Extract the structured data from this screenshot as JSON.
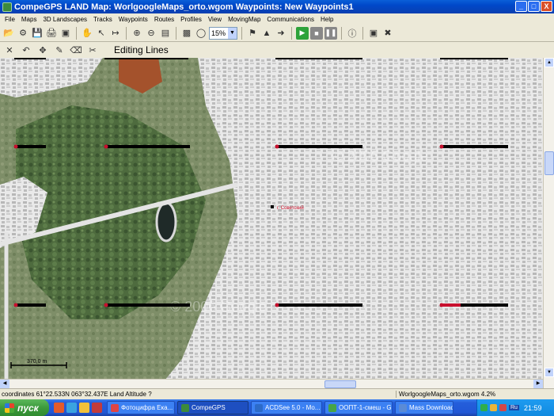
{
  "window": {
    "title": "CompeGPS LAND Map: WorlgoogleMaps_orto.wgom Waypoints:  New Waypoints1",
    "controls": [
      "_",
      "□",
      "X"
    ]
  },
  "menu": [
    "File",
    "Maps",
    "3D Landscapes",
    "Tracks",
    "Waypoints",
    "Routes",
    "Profiles",
    "View",
    "MovingMap",
    "Communications",
    "Help"
  ],
  "toolbar": {
    "zoom_value": "15%"
  },
  "editbar": {
    "mode_label": "Editing Lines"
  },
  "map": {
    "waypoint_label": "г. Советский",
    "scale_label": "370,0 m",
    "watermarks": [
      "© 2006 Google",
      "© 2006 Google"
    ],
    "colors": {
      "line": "#000000",
      "endpoint": "#c8102e",
      "label": "#d0102a"
    }
  },
  "status": {
    "coordinates": "coordinates 61°22.533N 063°32.437E Land Altitude ?",
    "map_name": "WorlgoogleMaps_orto.wgom 4.2%"
  },
  "taskbar": {
    "start_label": "пуск",
    "tasks": [
      "Фотоцифра Ека...",
      "CompeGPS",
      "ACDSee 5.0 - Мо...",
      "ООПТ-1-смеш - G...",
      "Mass Downloader"
    ],
    "tray_lang": "Ru",
    "clock": "21:59"
  }
}
